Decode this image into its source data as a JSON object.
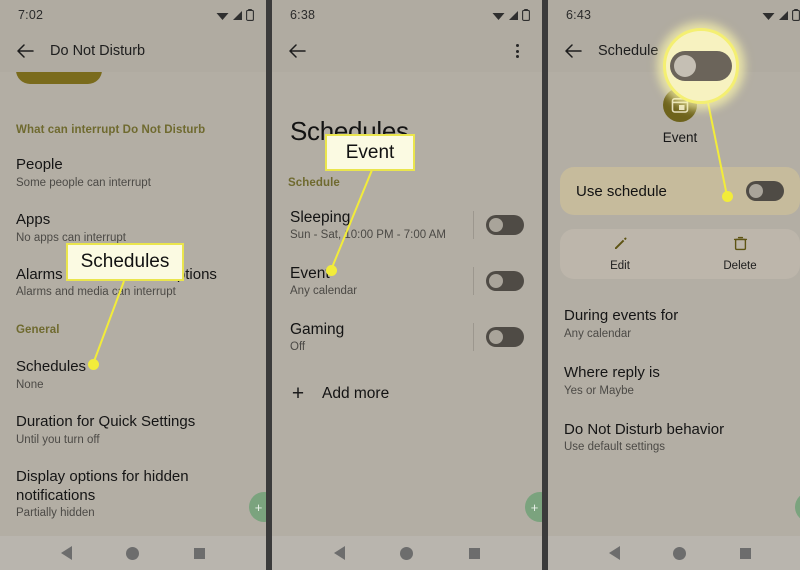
{
  "panels": [
    {
      "id": "do-not-disturb",
      "status": {
        "time": "7:02",
        "icons": [
          "wifi-icon",
          "signal-icon",
          "battery-icon"
        ]
      },
      "appbar": {
        "title": "Do Not Disturb",
        "back": "back-arrow-icon"
      },
      "section_label": "What can interrupt Do Not Disturb",
      "rows": [
        {
          "title": "People",
          "subtitle": "Some people can interrupt"
        },
        {
          "title": "Apps",
          "subtitle": "No apps can interrupt"
        },
        {
          "title": "Alarms and other interruptions",
          "subtitle": "Alarms and media can interrupt"
        }
      ],
      "general_label": "General",
      "general_rows": [
        {
          "title": "Schedules",
          "subtitle": "None"
        },
        {
          "title": "Duration for Quick Settings",
          "subtitle": "Until you turn off"
        },
        {
          "title": "Display options for hidden notifications",
          "subtitle": "Partially hidden"
        }
      ]
    },
    {
      "id": "schedules",
      "status": {
        "time": "6:38",
        "icons": [
          "wifi-icon",
          "signal-icon",
          "battery-icon"
        ]
      },
      "appbar": {
        "title": "",
        "back": "back-arrow-icon",
        "menu": "overflow-menu-icon"
      },
      "heading": "Schedules",
      "section_label": "Schedule",
      "items": [
        {
          "title": "Sleeping",
          "subtitle": "Sun - Sat, 10:00 PM - 7:00 AM",
          "toggle": "off"
        },
        {
          "title": "Event",
          "subtitle": "Any calendar",
          "toggle": "off"
        },
        {
          "title": "Gaming",
          "subtitle": "Off",
          "toggle": "off"
        }
      ],
      "add_more": "Add more"
    },
    {
      "id": "schedule-detail",
      "status": {
        "time": "6:43",
        "icons": [
          "wifi-icon",
          "signal-icon",
          "battery-icon"
        ]
      },
      "appbar": {
        "title": "Schedule",
        "back": "back-arrow-icon"
      },
      "event_icon_label": "Event",
      "use_schedule": {
        "label": "Use schedule",
        "toggle": "off"
      },
      "actions": [
        {
          "label": "Edit",
          "icon": "pencil-icon"
        },
        {
          "label": "Delete",
          "icon": "trash-icon"
        }
      ],
      "rows": [
        {
          "title": "During events for",
          "subtitle": "Any calendar"
        },
        {
          "title": "Where reply is",
          "subtitle": "Yes or Maybe"
        },
        {
          "title": "Do Not Disturb behavior",
          "subtitle": "Use default settings"
        }
      ]
    }
  ],
  "annotations": [
    {
      "text": "Schedules",
      "target": "schedules-row"
    },
    {
      "text": "Event",
      "target": "event-row"
    }
  ],
  "colors": {
    "accent_highlight": "#f2ec3a",
    "callout_bg": "#fbfae2",
    "panel_bg": "#b3aea4",
    "icon_olive": "#6e631c",
    "card_tan": "#c6bb9c",
    "fab_green": "#7ba37e"
  }
}
